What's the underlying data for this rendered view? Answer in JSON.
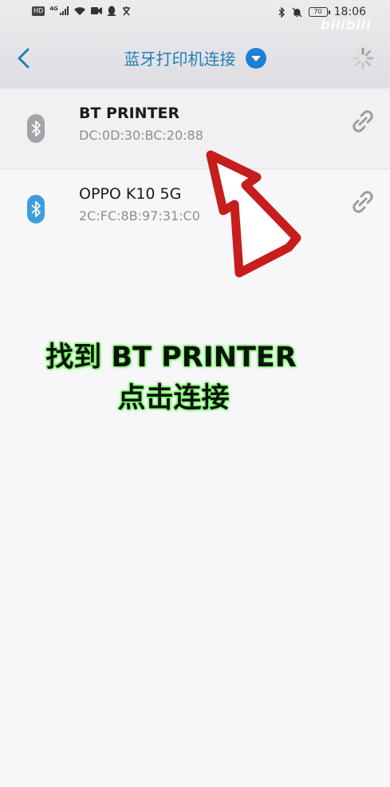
{
  "status_bar": {
    "hd": "HD",
    "network": "4G",
    "battery": "70",
    "time": "18:06",
    "watermark": "bilibili"
  },
  "header": {
    "title": "蓝牙打印机连接"
  },
  "devices": [
    {
      "name": "BT PRINTER",
      "mac": "DC:0D:30:BC:20:88",
      "icon_color": "#a3a3a8"
    },
    {
      "name": "OPPO K10 5G",
      "mac": "2C:FC:8B:97:31:C0",
      "icon_color": "#3f9ddc"
    }
  ],
  "instruction": {
    "line1": "找到 BT PRINTER",
    "line2": "点击连接"
  },
  "colors": {
    "accent": "#1f7fb6",
    "dropdown": "#1e7fd4",
    "arrow_red": "#c61d1d",
    "highlight_green": "#6aff55"
  },
  "icons": [
    "chevron-left-icon",
    "dropdown-icon",
    "loading-spinner-icon",
    "bluetooth-icon",
    "link-icon",
    "red-arrow-icon"
  ]
}
